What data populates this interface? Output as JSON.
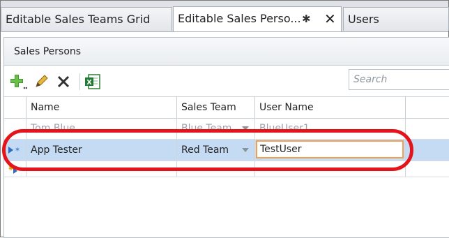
{
  "tabs": [
    {
      "label": "Editable Sales Teams Grid"
    },
    {
      "label": "Editable Sales Perso...",
      "pin": "✱",
      "close": "✕"
    },
    {
      "label": "Users"
    }
  ],
  "panel": {
    "title": "Sales Persons"
  },
  "toolbar": {
    "add_icon": "add-icon",
    "edit_icon": "pencil-icon",
    "delete_icon": "delete-icon",
    "export_icon": "excel-export-icon",
    "search_placeholder": "Search"
  },
  "grid": {
    "columns": [
      "Name",
      "Sales Team",
      "User Name"
    ],
    "rows": [
      {
        "name": "Tom Blue",
        "team": "Blue Team",
        "user": "BlueUser1"
      },
      {
        "name": "App Tester",
        "team": "Red Team",
        "user": "TestUser"
      }
    ]
  },
  "colors": {
    "selection": "#c5dbf3",
    "annotation": "#e4141b",
    "edit_border": "#f0a050"
  }
}
